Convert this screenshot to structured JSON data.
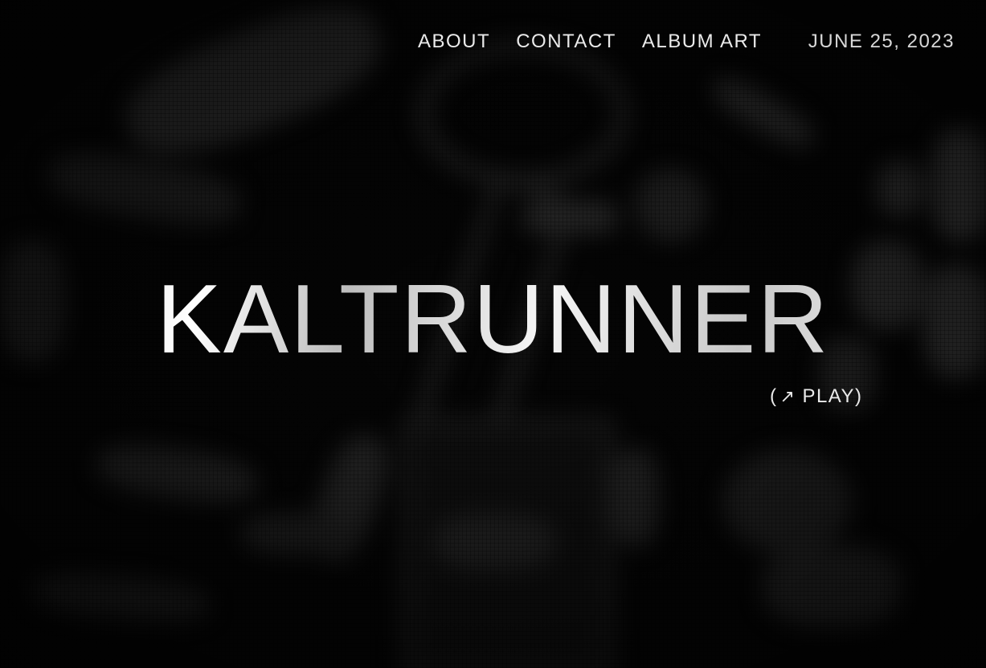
{
  "nav": {
    "items": [
      {
        "label": "ABOUT"
      },
      {
        "label": "CONTACT"
      },
      {
        "label": "ALBUM ART"
      }
    ]
  },
  "header": {
    "date": "JUNE 25, 2023"
  },
  "hero": {
    "title": "KALTRUNNER",
    "play_open": "(",
    "play_icon": "↗",
    "play_label": "PLAY)"
  },
  "icons": {
    "play_arrow": "arrow-up-right-icon"
  },
  "colors": {
    "background": "#060606",
    "text": "#eaeaea"
  }
}
